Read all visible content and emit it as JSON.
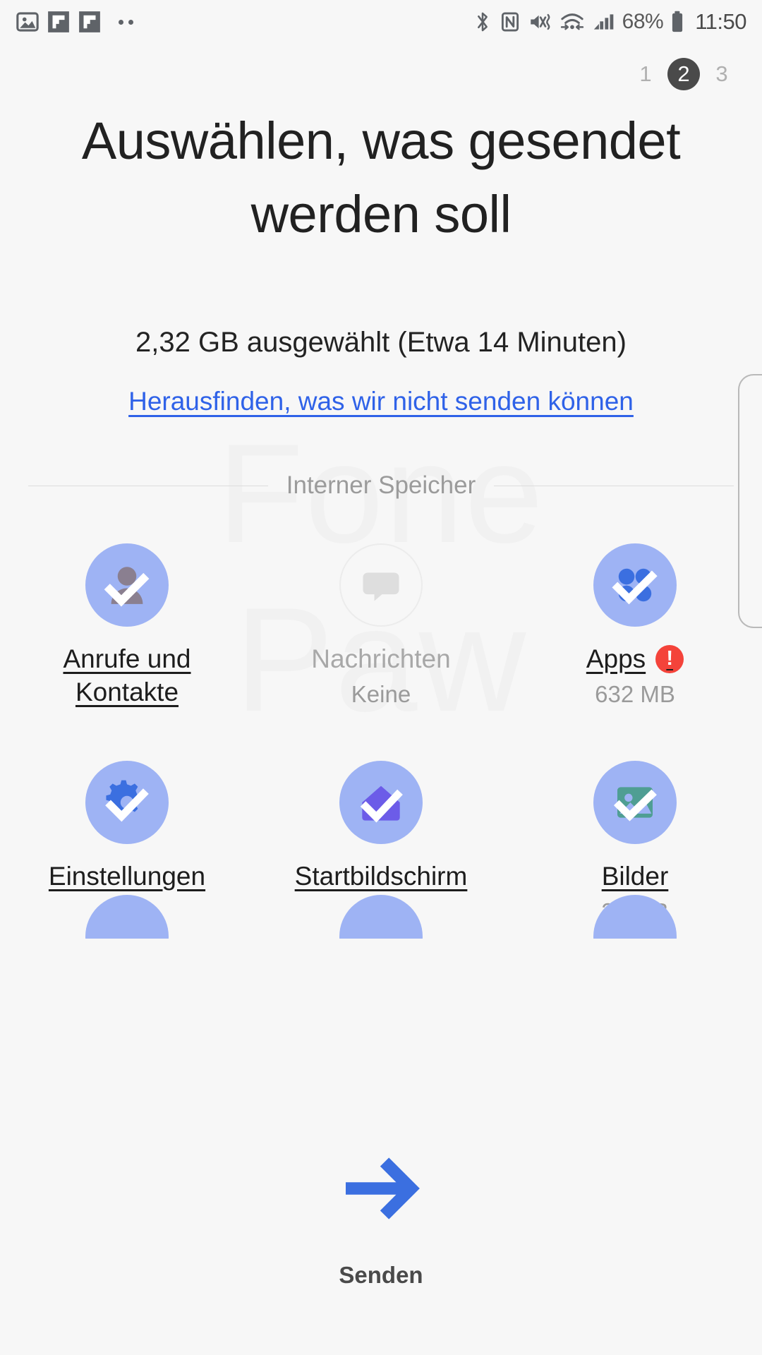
{
  "status_bar": {
    "left_icons": [
      "gallery-icon",
      "flipboard-icon",
      "flipboard-icon"
    ],
    "right_icons": [
      "bluetooth-icon",
      "nfc-icon",
      "mute-vibrate-icon",
      "wifi-transfer-icon",
      "signal-bars-icon"
    ],
    "battery_percent": "68%",
    "clock": "11:50"
  },
  "pager": {
    "steps": [
      "1",
      "2",
      "3"
    ],
    "active_index": 1
  },
  "header": {
    "title": "Auswählen, was gesendet werden soll",
    "subtitle": "2,32 GB  ausgewählt (Etwa 14 Minuten)",
    "link": "Herausfinden, was wir nicht senden können"
  },
  "section": {
    "divider_label": "Interner Speicher"
  },
  "watermark": {
    "line1": "Fone",
    "line2": "Paw"
  },
  "tiles": [
    {
      "id": "anrufe-und-kontakte",
      "label": "Anrufe und Kontakte",
      "sub": "",
      "icon": "contacts-check-icon",
      "selected": true,
      "disabled": false,
      "warning": false
    },
    {
      "id": "nachrichten",
      "label": "Nachrichten",
      "sub": "Keine",
      "icon": "message-bubble-icon",
      "selected": false,
      "disabled": true,
      "warning": false
    },
    {
      "id": "apps",
      "label": "Apps",
      "sub": "632 MB",
      "icon": "apps-check-icon",
      "selected": true,
      "disabled": false,
      "warning": true
    },
    {
      "id": "einstellungen",
      "label": "Einstellungen",
      "sub": "",
      "icon": "settings-gear-check-icon",
      "selected": true,
      "disabled": false,
      "warning": false
    },
    {
      "id": "startbildschirm",
      "label": "Startbildschirm",
      "sub": "",
      "icon": "home-check-icon",
      "selected": true,
      "disabled": false,
      "warning": false
    },
    {
      "id": "bilder",
      "label": "Bilder",
      "sub": "37 MB",
      "icon": "photo-check-icon",
      "selected": true,
      "disabled": false,
      "warning": false
    }
  ],
  "footer": {
    "send_label": "Senden",
    "send_icon": "arrow-right-icon"
  },
  "colors": {
    "background": "#f7f7f7",
    "bubble": "#9eb3f4",
    "link": "#2f62e8",
    "accent_blue": "#3b6fe0",
    "warning_red": "#f4433a",
    "pager_active": "#4a4a4a",
    "muted_text": "#9a9a9a"
  }
}
